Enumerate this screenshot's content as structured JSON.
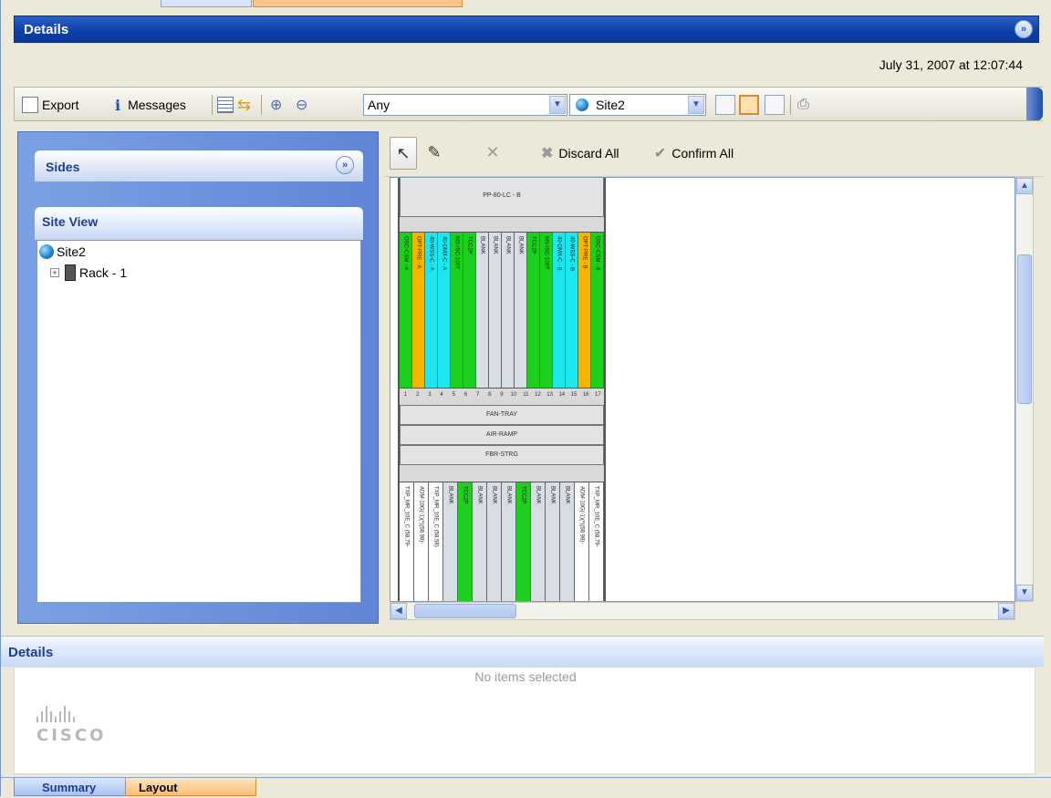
{
  "window": {
    "title": "Details",
    "timestamp": "July 31, 2007 at 12:07:44"
  },
  "toolbar": {
    "export_label": "Export",
    "messages_label": "Messages",
    "filter_value": "Any",
    "site_value": "Site2"
  },
  "left": {
    "sides_label": "Sides",
    "site_view_label": "Site View",
    "tree": {
      "root": "Site2",
      "child": "Rack - 1"
    }
  },
  "right": {
    "discard_label": "Discard All",
    "confirm_label": "Confirm All",
    "rack": {
      "top_shelf": "PP-80-LC - B",
      "upper_cards": [
        {
          "label": "OSC-CSM - A",
          "color": "#1ed01e"
        },
        {
          "label": "OPT-PRE - A",
          "color": "#f5b400"
        },
        {
          "label": "40-WSS-C - A",
          "color": "#1ee6f0"
        },
        {
          "label": "40-DMX-C - A",
          "color": "#1ee6f0"
        },
        {
          "label": "MS-ISC-100T",
          "color": "#1ed01e"
        },
        {
          "label": "TCC2P",
          "color": "#1ed01e"
        },
        {
          "label": "BLANK",
          "color": "#d9dde6"
        },
        {
          "label": "BLANK",
          "color": "#d9dde6"
        },
        {
          "label": "BLANK",
          "color": "#d9dde6"
        },
        {
          "label": "BLANK",
          "color": "#d9dde6"
        },
        {
          "label": "TCC2P",
          "color": "#1ed01e"
        },
        {
          "label": "MS-ISC-100T",
          "color": "#1ed01e"
        },
        {
          "label": "40-DMX-C - B",
          "color": "#1ee6f0"
        },
        {
          "label": "40-WSS-C - B",
          "color": "#1ee6f0"
        },
        {
          "label": "OPT-PRE - B",
          "color": "#f5b400"
        },
        {
          "label": "OSC-CSM - B",
          "color": "#1ed01e"
        }
      ],
      "slot_numbers": [
        "1",
        "2",
        "3",
        "4",
        "5",
        "6",
        "7",
        "8",
        "9",
        "10",
        "11",
        "12",
        "13",
        "14",
        "15",
        "16",
        "17"
      ],
      "mid_shelves": [
        "FAN-TRAY",
        "AIR-RAMP",
        "FBR-STRG"
      ],
      "lower_cards": [
        {
          "label": "TXP_MR_10E_C (58.79-",
          "color": "#ffffff"
        },
        {
          "label": "ADM-10G(-1)(*)(58.98)-",
          "color": "#ffffff"
        },
        {
          "label": "TXP_MR_10E_C (58.58)",
          "color": "#ffffff"
        },
        {
          "label": "BLANK",
          "color": "#d9dde6"
        },
        {
          "label": "TCC2P",
          "color": "#1ed01e"
        },
        {
          "label": "BLANK",
          "color": "#d9dde6"
        },
        {
          "label": "BLANK",
          "color": "#d9dde6"
        },
        {
          "label": "BLANK",
          "color": "#d9dde6"
        },
        {
          "label": "TCC2P",
          "color": "#1ed01e"
        },
        {
          "label": "BLANK",
          "color": "#d9dde6"
        },
        {
          "label": "BLANK",
          "color": "#d9dde6"
        },
        {
          "label": "BLANK",
          "color": "#d9dde6"
        },
        {
          "label": "ADM-10G(-1)(*)(58.98)-",
          "color": "#ffffff"
        },
        {
          "label": "TXP_MR_10E_C (58.79-",
          "color": "#ffffff"
        }
      ]
    }
  },
  "details": {
    "label": "Details",
    "empty_text": "No items selected",
    "logo_text": "CISCO"
  },
  "tabs": [
    "Summary",
    "Layout"
  ]
}
